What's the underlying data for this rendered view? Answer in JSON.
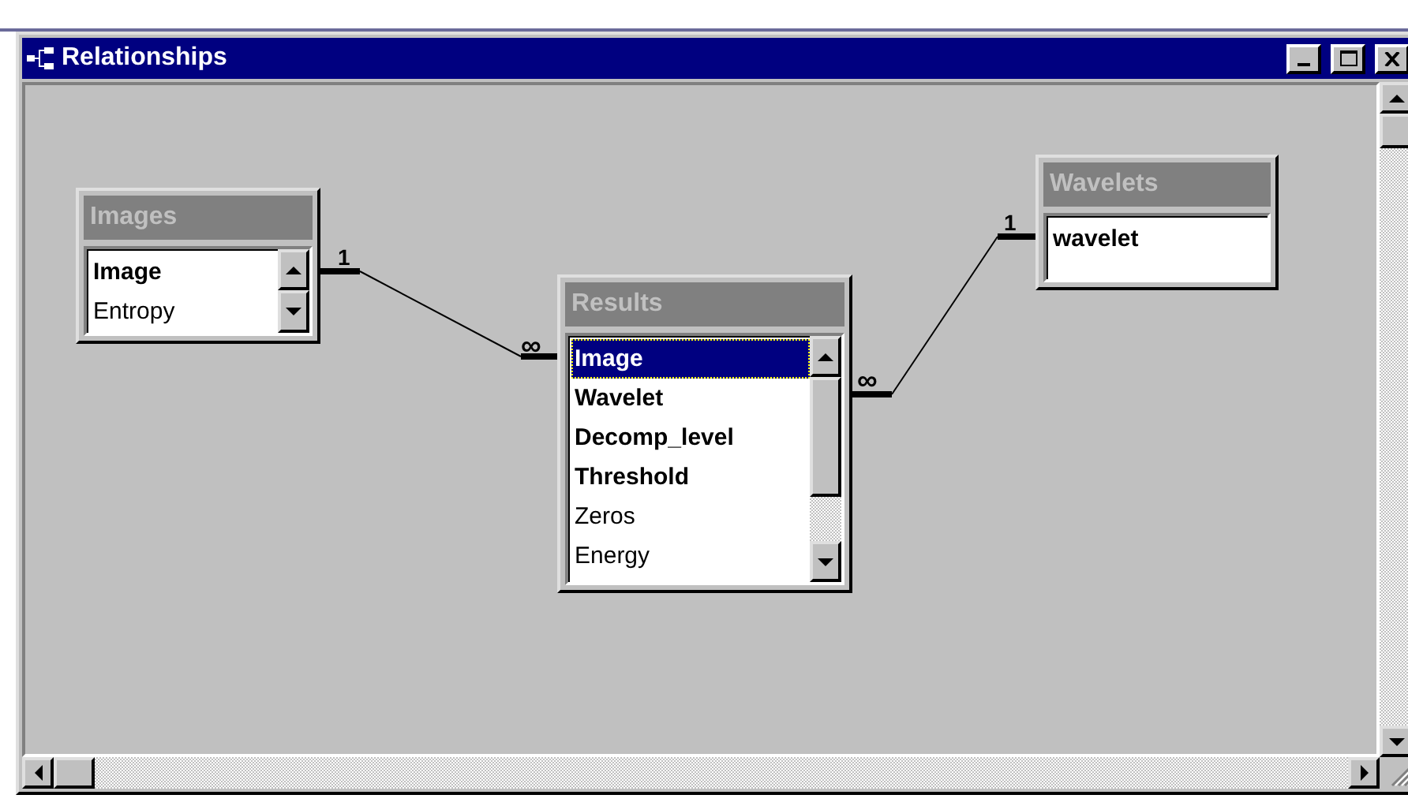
{
  "window": {
    "title": "Relationships"
  },
  "tables": [
    {
      "name": "Images",
      "has_scrollbar": true,
      "fields": [
        {
          "name": "Image",
          "primary_key": true,
          "selected": false
        },
        {
          "name": "Entropy",
          "primary_key": false,
          "selected": false
        }
      ]
    },
    {
      "name": "Results",
      "has_scrollbar": true,
      "fields": [
        {
          "name": "Image",
          "primary_key": true,
          "selected": true
        },
        {
          "name": "Wavelet",
          "primary_key": true,
          "selected": false
        },
        {
          "name": "Decomp_level",
          "primary_key": true,
          "selected": false
        },
        {
          "name": "Threshold",
          "primary_key": true,
          "selected": false
        },
        {
          "name": "Zeros",
          "primary_key": false,
          "selected": false
        },
        {
          "name": "Energy",
          "primary_key": false,
          "selected": false
        }
      ]
    },
    {
      "name": "Wavelets",
      "has_scrollbar": false,
      "fields": [
        {
          "name": "wavelet",
          "primary_key": true,
          "selected": false
        }
      ]
    }
  ],
  "relationships": [
    {
      "one_label": "1",
      "many_label": "∞"
    },
    {
      "many_label": "∞",
      "one_label": "1"
    }
  ]
}
